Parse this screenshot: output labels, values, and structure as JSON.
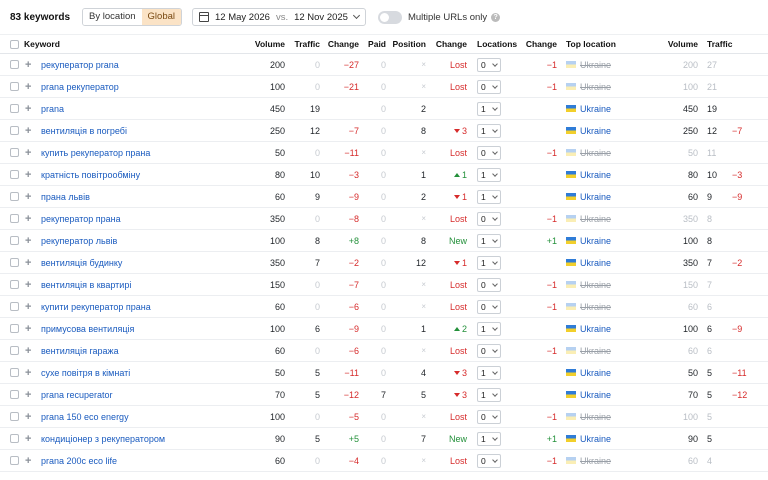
{
  "toolbar": {
    "keyword_count": "83 keywords",
    "seg_by_location": "By location",
    "seg_global": "Global",
    "date_from": "12 May 2026",
    "date_vs": "vs.",
    "date_to": "12 Nov 2025",
    "multiple_urls_label": "Multiple URLs only",
    "multiple_urls_on": false
  },
  "columns": {
    "keyword": "Keyword",
    "volume": "Volume",
    "traffic": "Traffic",
    "change": "Change",
    "paid": "Paid",
    "position": "Position",
    "pos_change": "Change",
    "locations": "Locations",
    "loc_change": "Change",
    "top_location": "Top location",
    "volume2": "Volume",
    "traffic2": "Traffic"
  },
  "rows": [
    {
      "keyword": "рекуператор prana",
      "volume": "200",
      "traffic": "0",
      "change": "−27",
      "paid": "0",
      "position": "×",
      "pos_change": "Lost",
      "locations": "0",
      "loc_change": "−1",
      "country": "Ukraine",
      "volume2": "200",
      "traffic2": "27",
      "change2": ""
    },
    {
      "keyword": "prana рекуператор",
      "volume": "100",
      "traffic": "0",
      "change": "−21",
      "paid": "0",
      "position": "×",
      "pos_change": "Lost",
      "locations": "0",
      "loc_change": "−1",
      "country": "Ukraine",
      "volume2": "100",
      "traffic2": "21",
      "change2": ""
    },
    {
      "keyword": "prana",
      "volume": "450",
      "traffic": "19",
      "change": "",
      "paid": "0",
      "position": "2",
      "pos_change": "",
      "locations": "1",
      "loc_change": "",
      "country": "Ukraine",
      "volume2": "450",
      "traffic2": "19",
      "change2": ""
    },
    {
      "keyword": "вентиляція в погребі",
      "volume": "250",
      "traffic": "12",
      "change": "−7",
      "paid": "0",
      "position": "8",
      "pos_change": "3",
      "locations": "1",
      "loc_change": "",
      "country": "Ukraine",
      "volume2": "250",
      "traffic2": "12",
      "change2": "−7"
    },
    {
      "keyword": "купить рекуператор прана",
      "volume": "50",
      "traffic": "0",
      "change": "−11",
      "paid": "0",
      "position": "×",
      "pos_change": "Lost",
      "locations": "0",
      "loc_change": "−1",
      "country": "Ukraine",
      "volume2": "50",
      "traffic2": "11",
      "change2": ""
    },
    {
      "keyword": "кратність повітрообміну",
      "volume": "80",
      "traffic": "10",
      "change": "−3",
      "paid": "0",
      "position": "1",
      "pos_change": "1",
      "locations": "1",
      "loc_change": "",
      "country": "Ukraine",
      "volume2": "80",
      "traffic2": "10",
      "change2": "−3"
    },
    {
      "keyword": "прана львів",
      "volume": "60",
      "traffic": "9",
      "change": "−9",
      "paid": "0",
      "position": "2",
      "pos_change": "1",
      "locations": "1",
      "loc_change": "",
      "country": "Ukraine",
      "volume2": "60",
      "traffic2": "9",
      "change2": "−9"
    },
    {
      "keyword": "рекуператор прана",
      "volume": "350",
      "traffic": "0",
      "change": "−8",
      "paid": "0",
      "position": "×",
      "pos_change": "Lost",
      "locations": "0",
      "loc_change": "−1",
      "country": "Ukraine",
      "volume2": "350",
      "traffic2": "8",
      "change2": ""
    },
    {
      "keyword": "рекуператор львів",
      "volume": "100",
      "traffic": "8",
      "change": "+8",
      "paid": "0",
      "position": "8",
      "pos_change": "New",
      "locations": "1",
      "loc_change": "+1",
      "country": "Ukraine",
      "volume2": "100",
      "traffic2": "8",
      "change2": ""
    },
    {
      "keyword": "вентиляція будинку",
      "volume": "350",
      "traffic": "7",
      "change": "−2",
      "paid": "0",
      "position": "12",
      "pos_change": "1",
      "locations": "1",
      "loc_change": "",
      "country": "Ukraine",
      "volume2": "350",
      "traffic2": "7",
      "change2": "−2"
    },
    {
      "keyword": "вентиляція в квартирі",
      "volume": "150",
      "traffic": "0",
      "change": "−7",
      "paid": "0",
      "position": "×",
      "pos_change": "Lost",
      "locations": "0",
      "loc_change": "−1",
      "country": "Ukraine",
      "volume2": "150",
      "traffic2": "7",
      "change2": ""
    },
    {
      "keyword": "купити рекуператор прана",
      "volume": "60",
      "traffic": "0",
      "change": "−6",
      "paid": "0",
      "position": "×",
      "pos_change": "Lost",
      "locations": "0",
      "loc_change": "−1",
      "country": "Ukraine",
      "volume2": "60",
      "traffic2": "6",
      "change2": ""
    },
    {
      "keyword": "примусова вентиляція",
      "volume": "100",
      "traffic": "6",
      "change": "−9",
      "paid": "0",
      "position": "1",
      "pos_change": "2",
      "locations": "1",
      "loc_change": "",
      "country": "Ukraine",
      "volume2": "100",
      "traffic2": "6",
      "change2": "−9"
    },
    {
      "keyword": "вентиляція гаража",
      "volume": "60",
      "traffic": "0",
      "change": "−6",
      "paid": "0",
      "position": "×",
      "pos_change": "Lost",
      "locations": "0",
      "loc_change": "−1",
      "country": "Ukraine",
      "volume2": "60",
      "traffic2": "6",
      "change2": ""
    },
    {
      "keyword": "сухе повітря в кімнаті",
      "volume": "50",
      "traffic": "5",
      "change": "−11",
      "paid": "0",
      "position": "4",
      "pos_change": "3",
      "locations": "1",
      "loc_change": "",
      "country": "Ukraine",
      "volume2": "50",
      "traffic2": "5",
      "change2": "−11"
    },
    {
      "keyword": "prana recuperator",
      "volume": "70",
      "traffic": "5",
      "change": "−12",
      "paid": "7",
      "position": "5",
      "pos_change": "3",
      "locations": "1",
      "loc_change": "",
      "country": "Ukraine",
      "volume2": "70",
      "traffic2": "5",
      "change2": "−12"
    },
    {
      "keyword": "prana 150 eco energy",
      "volume": "100",
      "traffic": "0",
      "change": "−5",
      "paid": "0",
      "position": "×",
      "pos_change": "Lost",
      "locations": "0",
      "loc_change": "−1",
      "country": "Ukraine",
      "volume2": "100",
      "traffic2": "5",
      "change2": ""
    },
    {
      "keyword": "кондиціонер з рекуператором",
      "volume": "90",
      "traffic": "5",
      "change": "+5",
      "paid": "0",
      "position": "7",
      "pos_change": "New",
      "locations": "1",
      "loc_change": "+1",
      "country": "Ukraine",
      "volume2": "90",
      "traffic2": "5",
      "change2": ""
    },
    {
      "keyword": "prana 200c eco life",
      "volume": "60",
      "traffic": "0",
      "change": "−4",
      "paid": "0",
      "position": "×",
      "pos_change": "Lost",
      "locations": "0",
      "loc_change": "−1",
      "country": "Ukraine",
      "volume2": "60",
      "traffic2": "4",
      "change2": ""
    }
  ],
  "row_meta": [
    {
      "dim": true,
      "pos_dir": ""
    },
    {
      "dim": true,
      "pos_dir": ""
    },
    {
      "dim": false,
      "pos_dir": ""
    },
    {
      "dim": false,
      "pos_dir": "down"
    },
    {
      "dim": true,
      "pos_dir": ""
    },
    {
      "dim": false,
      "pos_dir": "up"
    },
    {
      "dim": false,
      "pos_dir": "down"
    },
    {
      "dim": true,
      "pos_dir": ""
    },
    {
      "dim": false,
      "pos_dir": ""
    },
    {
      "dim": false,
      "pos_dir": "down"
    },
    {
      "dim": true,
      "pos_dir": ""
    },
    {
      "dim": true,
      "pos_dir": ""
    },
    {
      "dim": false,
      "pos_dir": "up"
    },
    {
      "dim": true,
      "pos_dir": ""
    },
    {
      "dim": false,
      "pos_dir": "down"
    },
    {
      "dim": false,
      "pos_dir": "down"
    },
    {
      "dim": true,
      "pos_dir": ""
    },
    {
      "dim": false,
      "pos_dir": ""
    },
    {
      "dim": true,
      "pos_dir": ""
    }
  ],
  "colors": {
    "link": "#1a5bbf",
    "negative": "#d62b2b",
    "positive": "#23903a",
    "global_active_bg": "#fbe3c6"
  }
}
